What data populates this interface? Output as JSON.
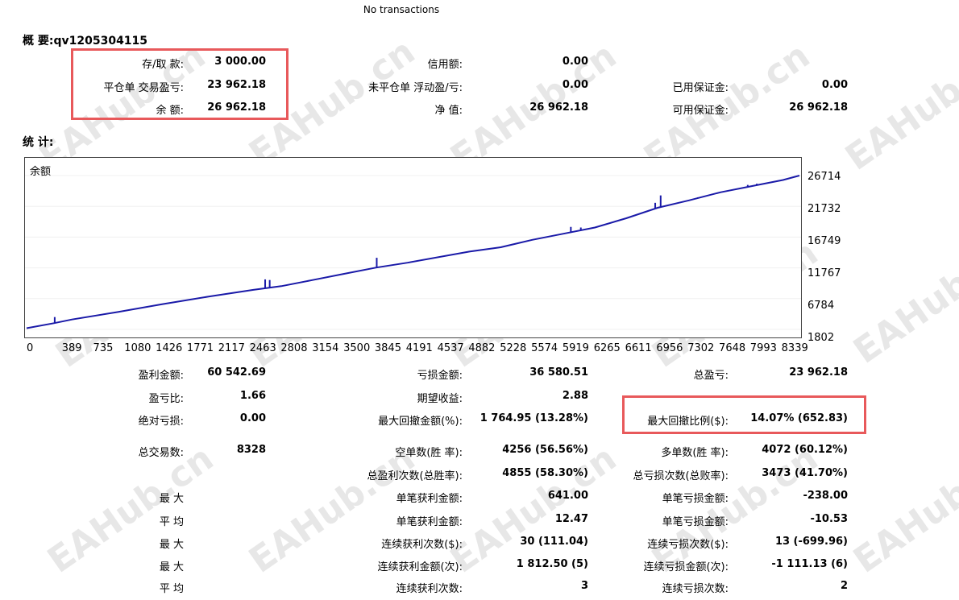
{
  "title": "No transactions",
  "summary": {
    "heading": "概 要:qv1205304115",
    "deposit_label": "存/取 款:",
    "deposit_value": "3 000.00",
    "closed_pl_label": "平仓单 交易盈亏:",
    "closed_pl_value": "23 962.18",
    "balance_label": "余 额:",
    "balance_value": "26 962.18",
    "credit_label": "信用额:",
    "credit_value": "0.00",
    "floating_label": "未平仓单 浮动盈/亏:",
    "floating_value": "0.00",
    "equity_label": "净 值:",
    "equity_value": "26 962.18",
    "margin_label": "已用保证金:",
    "margin_value": "0.00",
    "free_margin_label": "可用保证金:",
    "free_margin_value": "26 962.18"
  },
  "stats": {
    "heading": "统 计:",
    "rows": [
      {
        "l1": "盈利金额:",
        "v1": "60 542.69",
        "l2": "亏损金额:",
        "v2": "36 580.51",
        "l3": "总盈亏:",
        "v3": "23 962.18"
      },
      {
        "l1": "盈亏比:",
        "v1": "1.66",
        "l2": "期望收益:",
        "v2": "2.88",
        "l3": "",
        "v3": ""
      },
      {
        "l1": "绝对亏损:",
        "v1": "0.00",
        "l2": "最大回撤金额(%):",
        "v2": "1 764.95 (13.28%)",
        "l3": "最大回撤比例($):",
        "v3": "14.07% (652.83)"
      },
      {
        "l1": "总交易数:",
        "v1": "8328",
        "l2": "空单数(胜 率):",
        "v2": "4256 (56.56%)",
        "l3": "多单数(胜 率):",
        "v3": "4072 (60.12%)"
      },
      {
        "l1": "",
        "v1": "",
        "l2": "总盈利次数(总胜率):",
        "v2": "4855 (58.30%)",
        "l3": "总亏损次数(总败率):",
        "v3": "3473 (41.70%)"
      },
      {
        "l1": "最 大",
        "v1": "",
        "l2": "单笔获利金额:",
        "v2": "641.00",
        "l3": "单笔亏损金额:",
        "v3": "-238.00"
      },
      {
        "l1": "平 均",
        "v1": "",
        "l2": "单笔获利金额:",
        "v2": "12.47",
        "l3": "单笔亏损金额:",
        "v3": "-10.53"
      },
      {
        "l1": "最 大",
        "v1": "",
        "l2": "连续获利次数($):",
        "v2": "30 (111.04)",
        "l3": "连续亏损次数($):",
        "v3": "13 (-699.96)"
      },
      {
        "l1": "最 大",
        "v1": "",
        "l2": "连续获利金额(次):",
        "v2": "1 812.50 (5)",
        "l3": "连续亏损金额(次):",
        "v3": "-1 111.13 (6)"
      },
      {
        "l1": "平 均",
        "v1": "",
        "l2": "连续获利次数:",
        "v2": "3",
        "l3": "连续亏损次数:",
        "v3": "2"
      }
    ]
  },
  "watermark": "EAHub.cn",
  "colors": {
    "line": "#1a1aa8",
    "highlight": "#e8595b"
  },
  "chart_data": {
    "type": "line",
    "title": "余额",
    "x_ticks": [
      "0",
      "389",
      "735",
      "1080",
      "1426",
      "1771",
      "2117",
      "2463",
      "2808",
      "3154",
      "3500",
      "3845",
      "4191",
      "4537",
      "4882",
      "5228",
      "5574",
      "5919",
      "6265",
      "6611",
      "6956",
      "7302",
      "7648",
      "7993",
      "8339"
    ],
    "y_ticks": [
      "26714",
      "21732",
      "16749",
      "11767",
      "6784",
      "1802"
    ],
    "ylim": [
      1802,
      26714
    ],
    "xlim": [
      0,
      8520
    ],
    "series": [
      {
        "x": [
          0,
          300,
          500,
          1000,
          1500,
          2000,
          2500,
          2808,
          3154,
          3500,
          3850,
          4200,
          4882,
          5228,
          5574,
          5919,
          6265,
          6611,
          6956,
          7302,
          7648,
          7993,
          8339,
          8520
        ],
        "values": [
          2000,
          2800,
          3400,
          4600,
          5900,
          7100,
          8200,
          8800,
          9800,
          10800,
          11800,
          12600,
          14400,
          15100,
          16300,
          17300,
          18300,
          19800,
          21500,
          22700,
          24000,
          25000,
          26000,
          26714
        ],
        "spikes": [
          [
            310,
            3800
          ],
          [
            2630,
            9900
          ],
          [
            2680,
            9800
          ],
          [
            3860,
            13400
          ],
          [
            6000,
            18400
          ],
          [
            6110,
            18300
          ],
          [
            6930,
            22300
          ],
          [
            6990,
            23500
          ],
          [
            7400,
            23200
          ],
          [
            7950,
            25200
          ],
          [
            8050,
            25400
          ]
        ]
      }
    ]
  }
}
